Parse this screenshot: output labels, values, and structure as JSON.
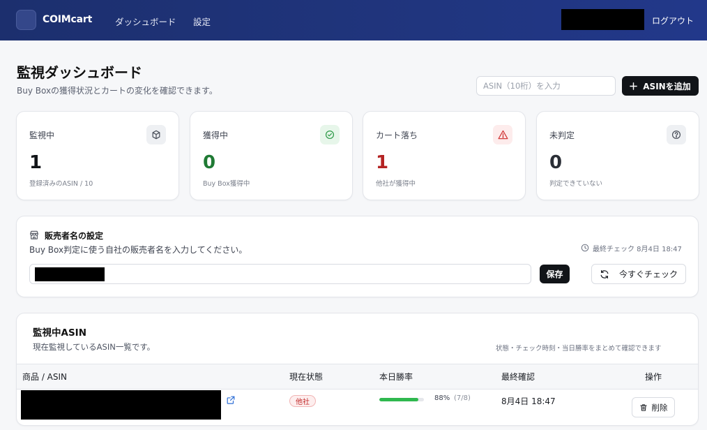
{
  "header": {
    "brand": "COIMcart",
    "nav": [
      "ダッシュボード",
      "設定"
    ],
    "logout": "ログアウト"
  },
  "page": {
    "title": "監視ダッシュボード",
    "subtitle": "Buy Boxの獲得状況とカートの変化を確認できます。",
    "asin_placeholder": "ASIN（10桁）を入力",
    "add_button": "ASINを追加"
  },
  "stats": [
    {
      "label": "監視中",
      "value": "1",
      "desc": "登録済みのASIN / 10",
      "icon": "box-icon",
      "value_color": "#111418",
      "icon_bg": "#eef0f3",
      "icon_color": "#4a4f5a"
    },
    {
      "label": "獲得中",
      "value": "0",
      "desc": "Buy Box獲得中",
      "icon": "check-circle-icon",
      "value_color": "#1f7a34",
      "icon_bg": "#e7f6ea",
      "icon_color": "#2d9a47"
    },
    {
      "label": "カート落ち",
      "value": "1",
      "desc": "他社が獲得中",
      "icon": "alert-triangle-icon",
      "value_color": "#b42323",
      "icon_bg": "#fdecec",
      "icon_color": "#d23b3b"
    },
    {
      "label": "未判定",
      "value": "0",
      "desc": "判定できていない",
      "icon": "help-circle-icon",
      "value_color": "#2a2e36",
      "icon_bg": "#eef0f3",
      "icon_color": "#4a4f5a"
    }
  ],
  "seller": {
    "title": "販売者名の設定",
    "subtitle": "Buy Box判定に使う自社の販売者名を入力してください。",
    "last_check": "最終チェック 8月4日 18:47",
    "save_label": "保存",
    "check_label": "今すぐチェック"
  },
  "asin_list": {
    "title": "監視中ASIN",
    "subtitle": "現在監視しているASIN一覧です。",
    "note": "状態・チェック時刻・当日勝率をまとめて確認できます",
    "columns": [
      "商品 / ASIN",
      "現在状態",
      "本日勝率",
      "最終確認",
      "操作"
    ],
    "rows": [
      {
        "status": "他社",
        "win_rate_pct": "88%",
        "win_rate_ratio": "(7/8)",
        "win_rate": 0.88,
        "last_confirmed": "8月4日 18:47",
        "action": "削除"
      }
    ]
  },
  "colors": {
    "header_bg": "#1f3378",
    "accent_dark": "#111418",
    "success": "#2fb84f",
    "danger": "#c22a2a"
  }
}
